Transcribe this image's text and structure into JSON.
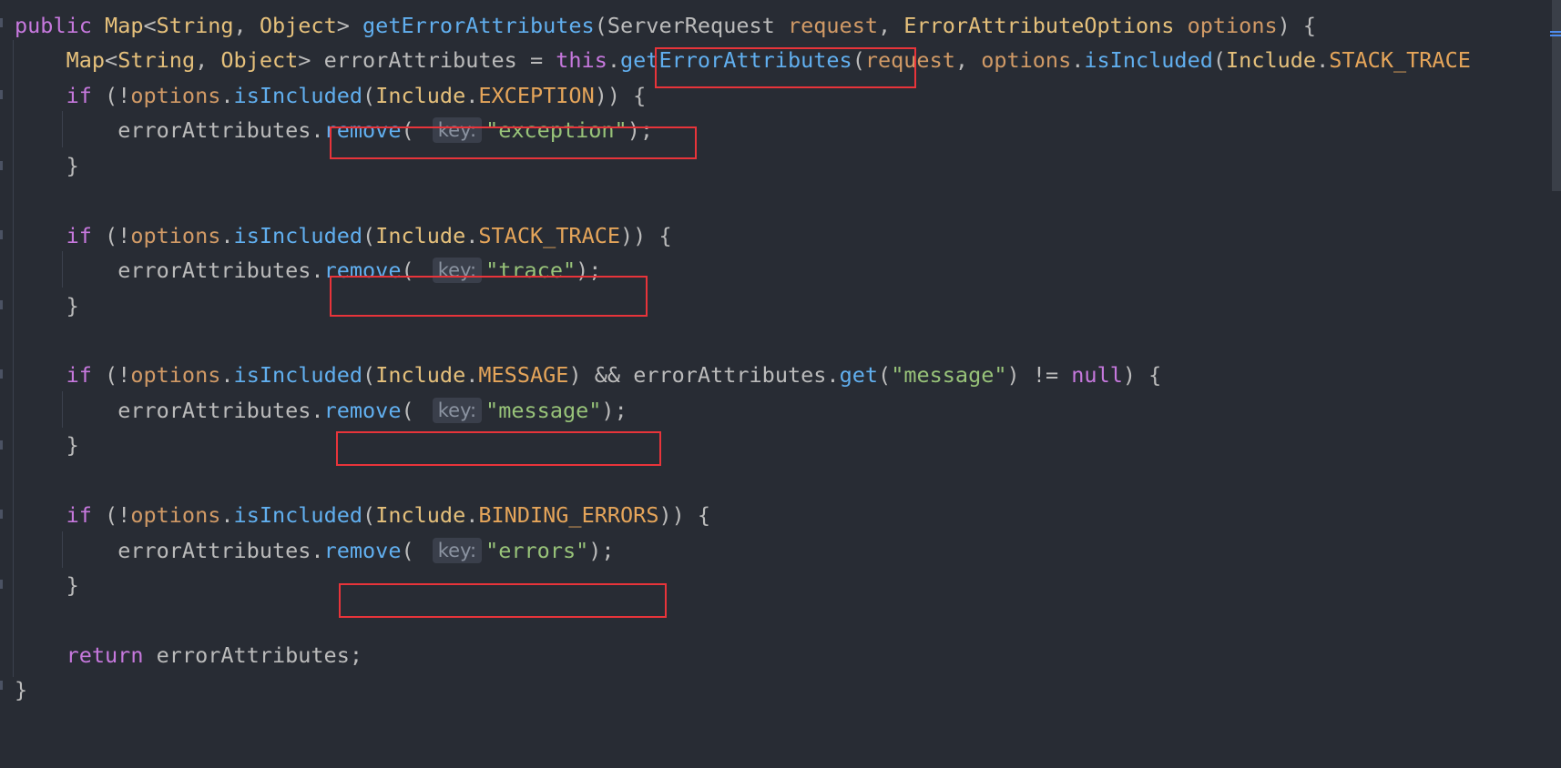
{
  "code": {
    "public": "public",
    "map": "Map",
    "lt": "<",
    "string": "String",
    "comma": ", ",
    "object": "Object",
    "gt": "> ",
    "get_error_attributes": "getErrorAttributes",
    "open_paren": "(",
    "server_request": "ServerRequest",
    "request": "request",
    "error_attribute_options": "ErrorAttributeOptions",
    "options": "options",
    "sig_close": ") {",
    "error_attributes": "errorAttributes",
    "assign": " = ",
    "this": "this",
    "dot": ".",
    "is_included": "isIncluded",
    "include": "Include",
    "stack_trace": "STACK_TRACE",
    "if": "if",
    "if_open": " (!",
    "exception_const": "EXCEPTION",
    "cond_close": ")) {",
    "remove": "remove",
    "remove_open": "( ",
    "key_hint": "key:",
    "exception_str": "\"exception\"",
    "call_close": ");",
    "close_brace": "}",
    "message_const": "MESSAGE",
    "and": ") && ",
    "get": "get",
    "message_str": "\"message\"",
    "neq": ") != ",
    "null": "null",
    "null_close": ") {",
    "binding_errors": "BINDING_ERRORS",
    "trace_str": "\"trace\"",
    "errors_str": "\"errors\"",
    "return": "return",
    "return_rest": " errorAttributes;"
  },
  "colors": {
    "background": "#282c34",
    "keyword": "#c678dd",
    "type": "#e5c07b",
    "function": "#61afef",
    "string": "#98c379",
    "parameter": "#d19a66",
    "highlight_box": "#e8343a"
  }
}
